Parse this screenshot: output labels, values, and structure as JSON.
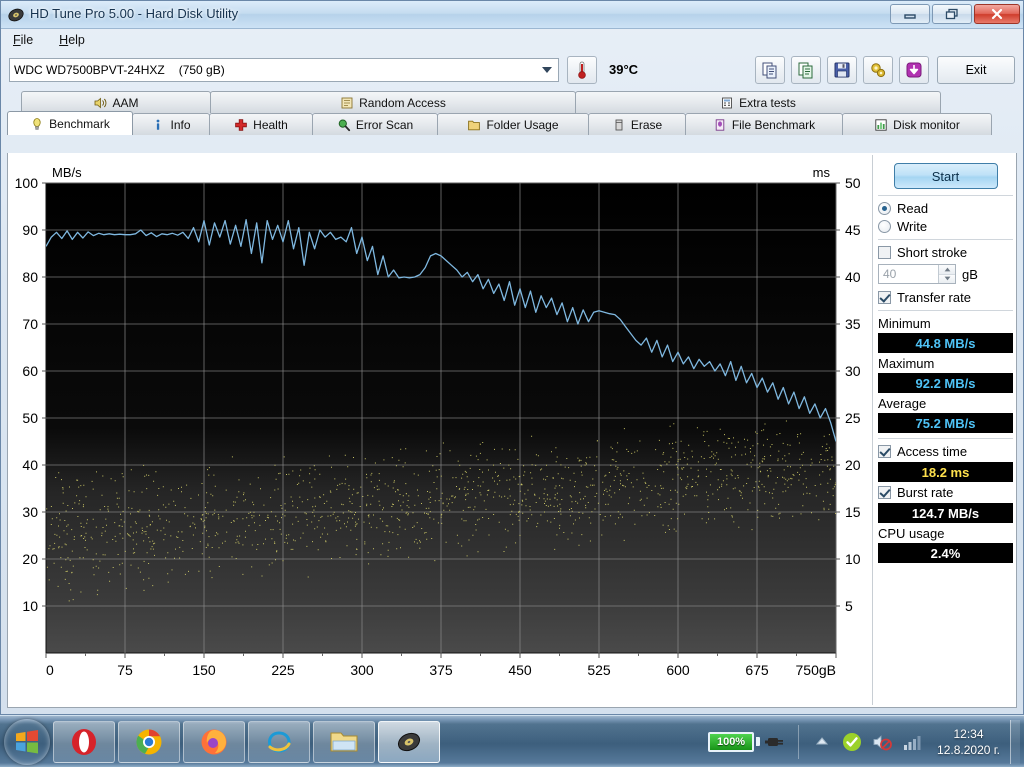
{
  "window": {
    "title": "HD Tune Pro 5.00 - Hard Disk Utility",
    "icon": "hdtune-icon",
    "minimize": "minimize-icon",
    "restore": "restore-icon",
    "close": "close-icon"
  },
  "menu": {
    "items": [
      {
        "label": "File",
        "accel": "F"
      },
      {
        "label": "Help",
        "accel": "H"
      }
    ]
  },
  "toolbar": {
    "drive": "WDC WD7500BPVT-24HXZ",
    "drive_size": "(750 gB)",
    "temperature": "39°C",
    "temp_icon": "thermometer-icon",
    "buttons": [
      {
        "name": "copy-text-button",
        "icon": "copy-text-icon"
      },
      {
        "name": "copy-image-button",
        "icon": "copy-image-icon"
      },
      {
        "name": "save-button",
        "icon": "floppy-disk-icon"
      },
      {
        "name": "options-button",
        "icon": "gears-icon"
      },
      {
        "name": "download-button",
        "icon": "download-arrow-icon"
      }
    ],
    "exit_label": "Exit"
  },
  "tabs": {
    "top_row": [
      {
        "label": "AAM",
        "icon": "speaker-icon",
        "active": false
      },
      {
        "label": "Random Access",
        "icon": "random-access-icon",
        "active": false
      },
      {
        "label": "Extra tests",
        "icon": "extra-tests-icon",
        "active": false
      }
    ],
    "bottom_row": [
      {
        "label": "Benchmark",
        "icon": "bulb-icon",
        "active": true
      },
      {
        "label": "Info",
        "icon": "info-icon",
        "active": false
      },
      {
        "label": "Health",
        "icon": "health-cross-icon",
        "active": false
      },
      {
        "label": "Error Scan",
        "icon": "magnifier-icon",
        "active": false
      },
      {
        "label": "Folder Usage",
        "icon": "folder-icon",
        "active": false
      },
      {
        "label": "Erase",
        "icon": "eraser-icon",
        "active": false
      },
      {
        "label": "File Benchmark",
        "icon": "file-benchmark-icon",
        "active": false
      },
      {
        "label": "Disk monitor",
        "icon": "disk-monitor-icon",
        "active": false
      }
    ]
  },
  "panel": {
    "start_label": "Start",
    "mode": {
      "read_label": "Read",
      "write_label": "Write",
      "selected": "Read"
    },
    "short_stroke": {
      "label": "Short stroke",
      "checked": false,
      "value": "40",
      "unit": "gB"
    },
    "transfer_rate": {
      "label": "Transfer rate",
      "checked": true
    },
    "minimum_label": "Minimum",
    "minimum_value": "44.8 MB/s",
    "maximum_label": "Maximum",
    "maximum_value": "92.2 MB/s",
    "average_label": "Average",
    "average_value": "75.2 MB/s",
    "access_time": {
      "label": "Access time",
      "checked": true,
      "value": "18.2 ms"
    },
    "burst_rate": {
      "label": "Burst rate",
      "checked": true,
      "value": "124.7 MB/s"
    },
    "cpu_usage": {
      "label": "CPU usage",
      "value": "2.4%"
    },
    "colors": {
      "transfer": "#7fb8e0",
      "access": "#d8d46a",
      "value_cyan": "#4fc3f7",
      "value_yellow": "#ffe14d"
    }
  },
  "chart_data": {
    "type": "line",
    "title": "",
    "xlabel": "750gB",
    "ylabel": "MB/s",
    "y2label": "ms",
    "xlim": [
      0,
      750
    ],
    "ylim": [
      0,
      100
    ],
    "y2lim": [
      0,
      50
    ],
    "xticks": [
      0,
      75,
      150,
      225,
      300,
      375,
      450,
      525,
      600,
      675,
      750
    ],
    "xticklabels": [
      "0",
      "75",
      "150",
      "225",
      "300",
      "375",
      "450",
      "525",
      "600",
      "675",
      "750gB"
    ],
    "yticks": [
      10,
      20,
      30,
      40,
      50,
      60,
      70,
      80,
      90,
      100
    ],
    "y2ticks": [
      5,
      10,
      15,
      20,
      25,
      30,
      35,
      40,
      45,
      50
    ],
    "grid": true,
    "legend": "none",
    "series": [
      {
        "name": "Transfer rate",
        "type": "line",
        "color": "#7fb8e0",
        "axis": "left",
        "x": [
          0,
          5,
          10,
          15,
          20,
          25,
          30,
          35,
          40,
          45,
          50,
          55,
          60,
          65,
          70,
          75,
          80,
          85,
          90,
          95,
          100,
          105,
          110,
          115,
          120,
          125,
          130,
          135,
          140,
          145,
          150,
          155,
          160,
          165,
          170,
          175,
          180,
          185,
          190,
          195,
          200,
          205,
          210,
          215,
          220,
          225,
          230,
          235,
          240,
          245,
          250,
          255,
          260,
          265,
          270,
          275,
          280,
          285,
          290,
          295,
          300,
          305,
          310,
          315,
          320,
          325,
          330,
          335,
          340,
          345,
          350,
          355,
          360,
          365,
          370,
          375,
          380,
          385,
          390,
          395,
          400,
          405,
          410,
          415,
          420,
          425,
          430,
          435,
          440,
          445,
          450,
          455,
          460,
          465,
          470,
          475,
          480,
          485,
          490,
          495,
          500,
          505,
          510,
          515,
          520,
          525,
          530,
          535,
          540,
          545,
          550,
          555,
          560,
          565,
          570,
          575,
          580,
          585,
          590,
          595,
          600,
          605,
          610,
          615,
          620,
          625,
          630,
          635,
          640,
          645,
          650,
          655,
          660,
          665,
          670,
          675,
          680,
          685,
          690,
          695,
          700,
          705,
          710,
          715,
          720,
          725,
          730,
          735,
          740,
          745,
          750
        ],
        "y": [
          86.5,
          88.5,
          89.5,
          88.2,
          89.8,
          88.0,
          89.5,
          88.3,
          89.6,
          88.8,
          89.3,
          89.0,
          89.2,
          89.0,
          89.1,
          89.0,
          89.0,
          89.2,
          90.0,
          88.8,
          89.4,
          88.6,
          89.2,
          89.0,
          89.3,
          88.9,
          89.5,
          88.2,
          90.5,
          87.5,
          92.0,
          86.8,
          91.5,
          88.5,
          92.0,
          87.0,
          91.0,
          86.5,
          92.2,
          85.0,
          91.5,
          83.0,
          92.0,
          88.0,
          91.0,
          87.5,
          92.0,
          86.0,
          90.5,
          82.5,
          89.5,
          86.0,
          90.0,
          88.5,
          89.5,
          88.0,
          88.5,
          87.5,
          90.5,
          85.0,
          88.5,
          83.5,
          86.5,
          80.5,
          84.5,
          80.0,
          81.5,
          79.8,
          80.0,
          79.8,
          80.0,
          80.5,
          82.0,
          84.5,
          85.0,
          84.5,
          83.5,
          82.5,
          81.5,
          80.0,
          81.0,
          79.0,
          80.5,
          77.5,
          79.5,
          76.5,
          78.5,
          75.0,
          79.0,
          74.0,
          77.5,
          73.5,
          77.0,
          72.5,
          76.0,
          73.5,
          75.5,
          72.0,
          74.5,
          70.5,
          73.5,
          70.0,
          73.0,
          70.5,
          72.5,
          72.8,
          72.5,
          72.2,
          72.0,
          71.0,
          69.5,
          68.0,
          66.5,
          65.5,
          67.0,
          64.0,
          66.5,
          63.0,
          65.5,
          62.0,
          64.0,
          61.5,
          63.0,
          60.5,
          62.5,
          61.0,
          62.0,
          60.0,
          61.5,
          59.0,
          62.0,
          58.0,
          61.0,
          57.5,
          59.5,
          56.5,
          58.5,
          55.5,
          57.5,
          54.0,
          56.5,
          53.0,
          55.5,
          52.0,
          54.5,
          51.0,
          53.0,
          50.0,
          52.0,
          49.0,
          45.0
        ]
      },
      {
        "name": "Access time",
        "type": "scatter",
        "color": "#d8d46a",
        "axis": "right",
        "point_count": 1400,
        "description": "Dense yellow scatter cloud rising from roughly 5-20 ms at 0 gB to roughly 14-26 ms near 750 gB",
        "band_start_ms": [
          5,
          20
        ],
        "band_end_ms": [
          14,
          26
        ]
      }
    ]
  },
  "taskbar": {
    "start": "windows-start-orb",
    "items": [
      {
        "name": "opera-icon",
        "active": false
      },
      {
        "name": "chrome-icon",
        "active": false
      },
      {
        "name": "firefox-icon",
        "active": false
      },
      {
        "name": "internet-explorer-icon",
        "active": false
      },
      {
        "name": "file-explorer-icon",
        "active": false
      },
      {
        "name": "hdtune-icon",
        "active": true
      }
    ],
    "tray": {
      "battery_percent": "100%",
      "battery_icon": "battery-icon",
      "plug_icon": "power-plug-icon",
      "overflow_icon": "show-hidden-icons-arrow",
      "shield_icon": "action-center-check-icon",
      "volume_icon": "volume-muted-icon",
      "network_icon": "network-bars-icon",
      "time": "12:34",
      "date": "12.8.2020 г."
    }
  }
}
